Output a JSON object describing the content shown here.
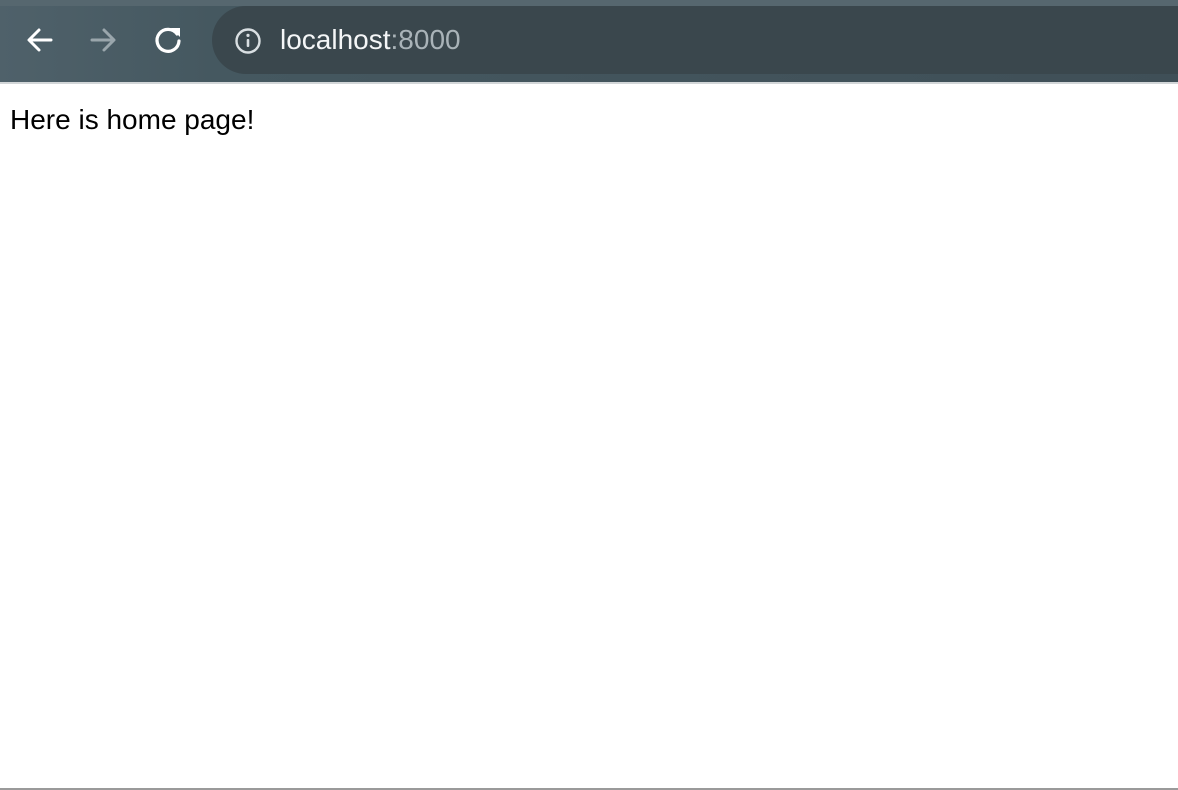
{
  "browser": {
    "address_bar": {
      "host": "localhost",
      "port": ":8000"
    },
    "icons": {
      "back": "arrow-left-icon",
      "forward": "arrow-right-icon",
      "reload": "reload-icon",
      "site_info": "info-icon"
    },
    "colors": {
      "toolbar": "#455860",
      "omnibox": "#3a474d",
      "url_host": "#f4f6f7",
      "url_port": "#a9b3b8"
    }
  },
  "page": {
    "body_text": "Here is home page!"
  }
}
